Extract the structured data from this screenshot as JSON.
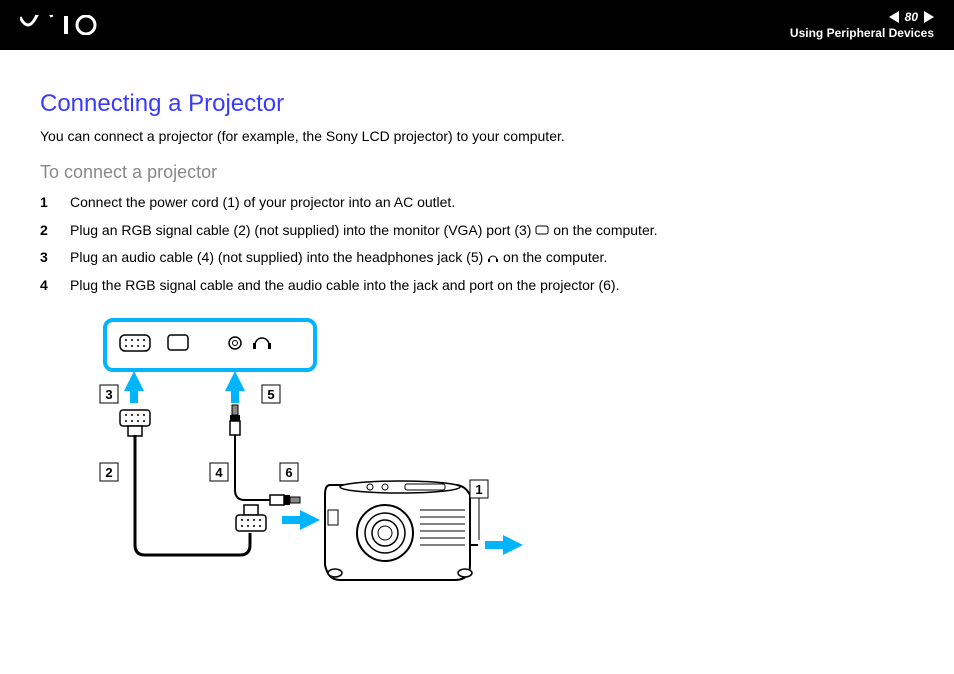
{
  "header": {
    "page_number": "80",
    "section": "Using Peripheral Devices"
  },
  "title": "Connecting a Projector",
  "intro": "You can connect a projector (for example, the Sony LCD projector) to your computer.",
  "subheading": "To connect a projector",
  "steps": [
    {
      "num": "1",
      "text_before": "Connect the power cord (1) of your projector into an AC outlet.",
      "icon": null,
      "text_after": ""
    },
    {
      "num": "2",
      "text_before": "Plug an RGB signal cable (2) (not supplied) into the monitor (VGA) port (3) ",
      "icon": "monitor",
      "text_after": " on the computer."
    },
    {
      "num": "3",
      "text_before": "Plug an audio cable (4) (not supplied) into the headphones jack (5) ",
      "icon": "headphone",
      "text_after": " on the computer."
    },
    {
      "num": "4",
      "text_before": "Plug the RGB signal cable and the audio cable into the jack and port on the projector (6).",
      "icon": null,
      "text_after": ""
    }
  ],
  "diagram": {
    "labels": {
      "l1": "1",
      "l2": "2",
      "l3": "3",
      "l4": "4",
      "l5": "5",
      "l6": "6"
    }
  }
}
